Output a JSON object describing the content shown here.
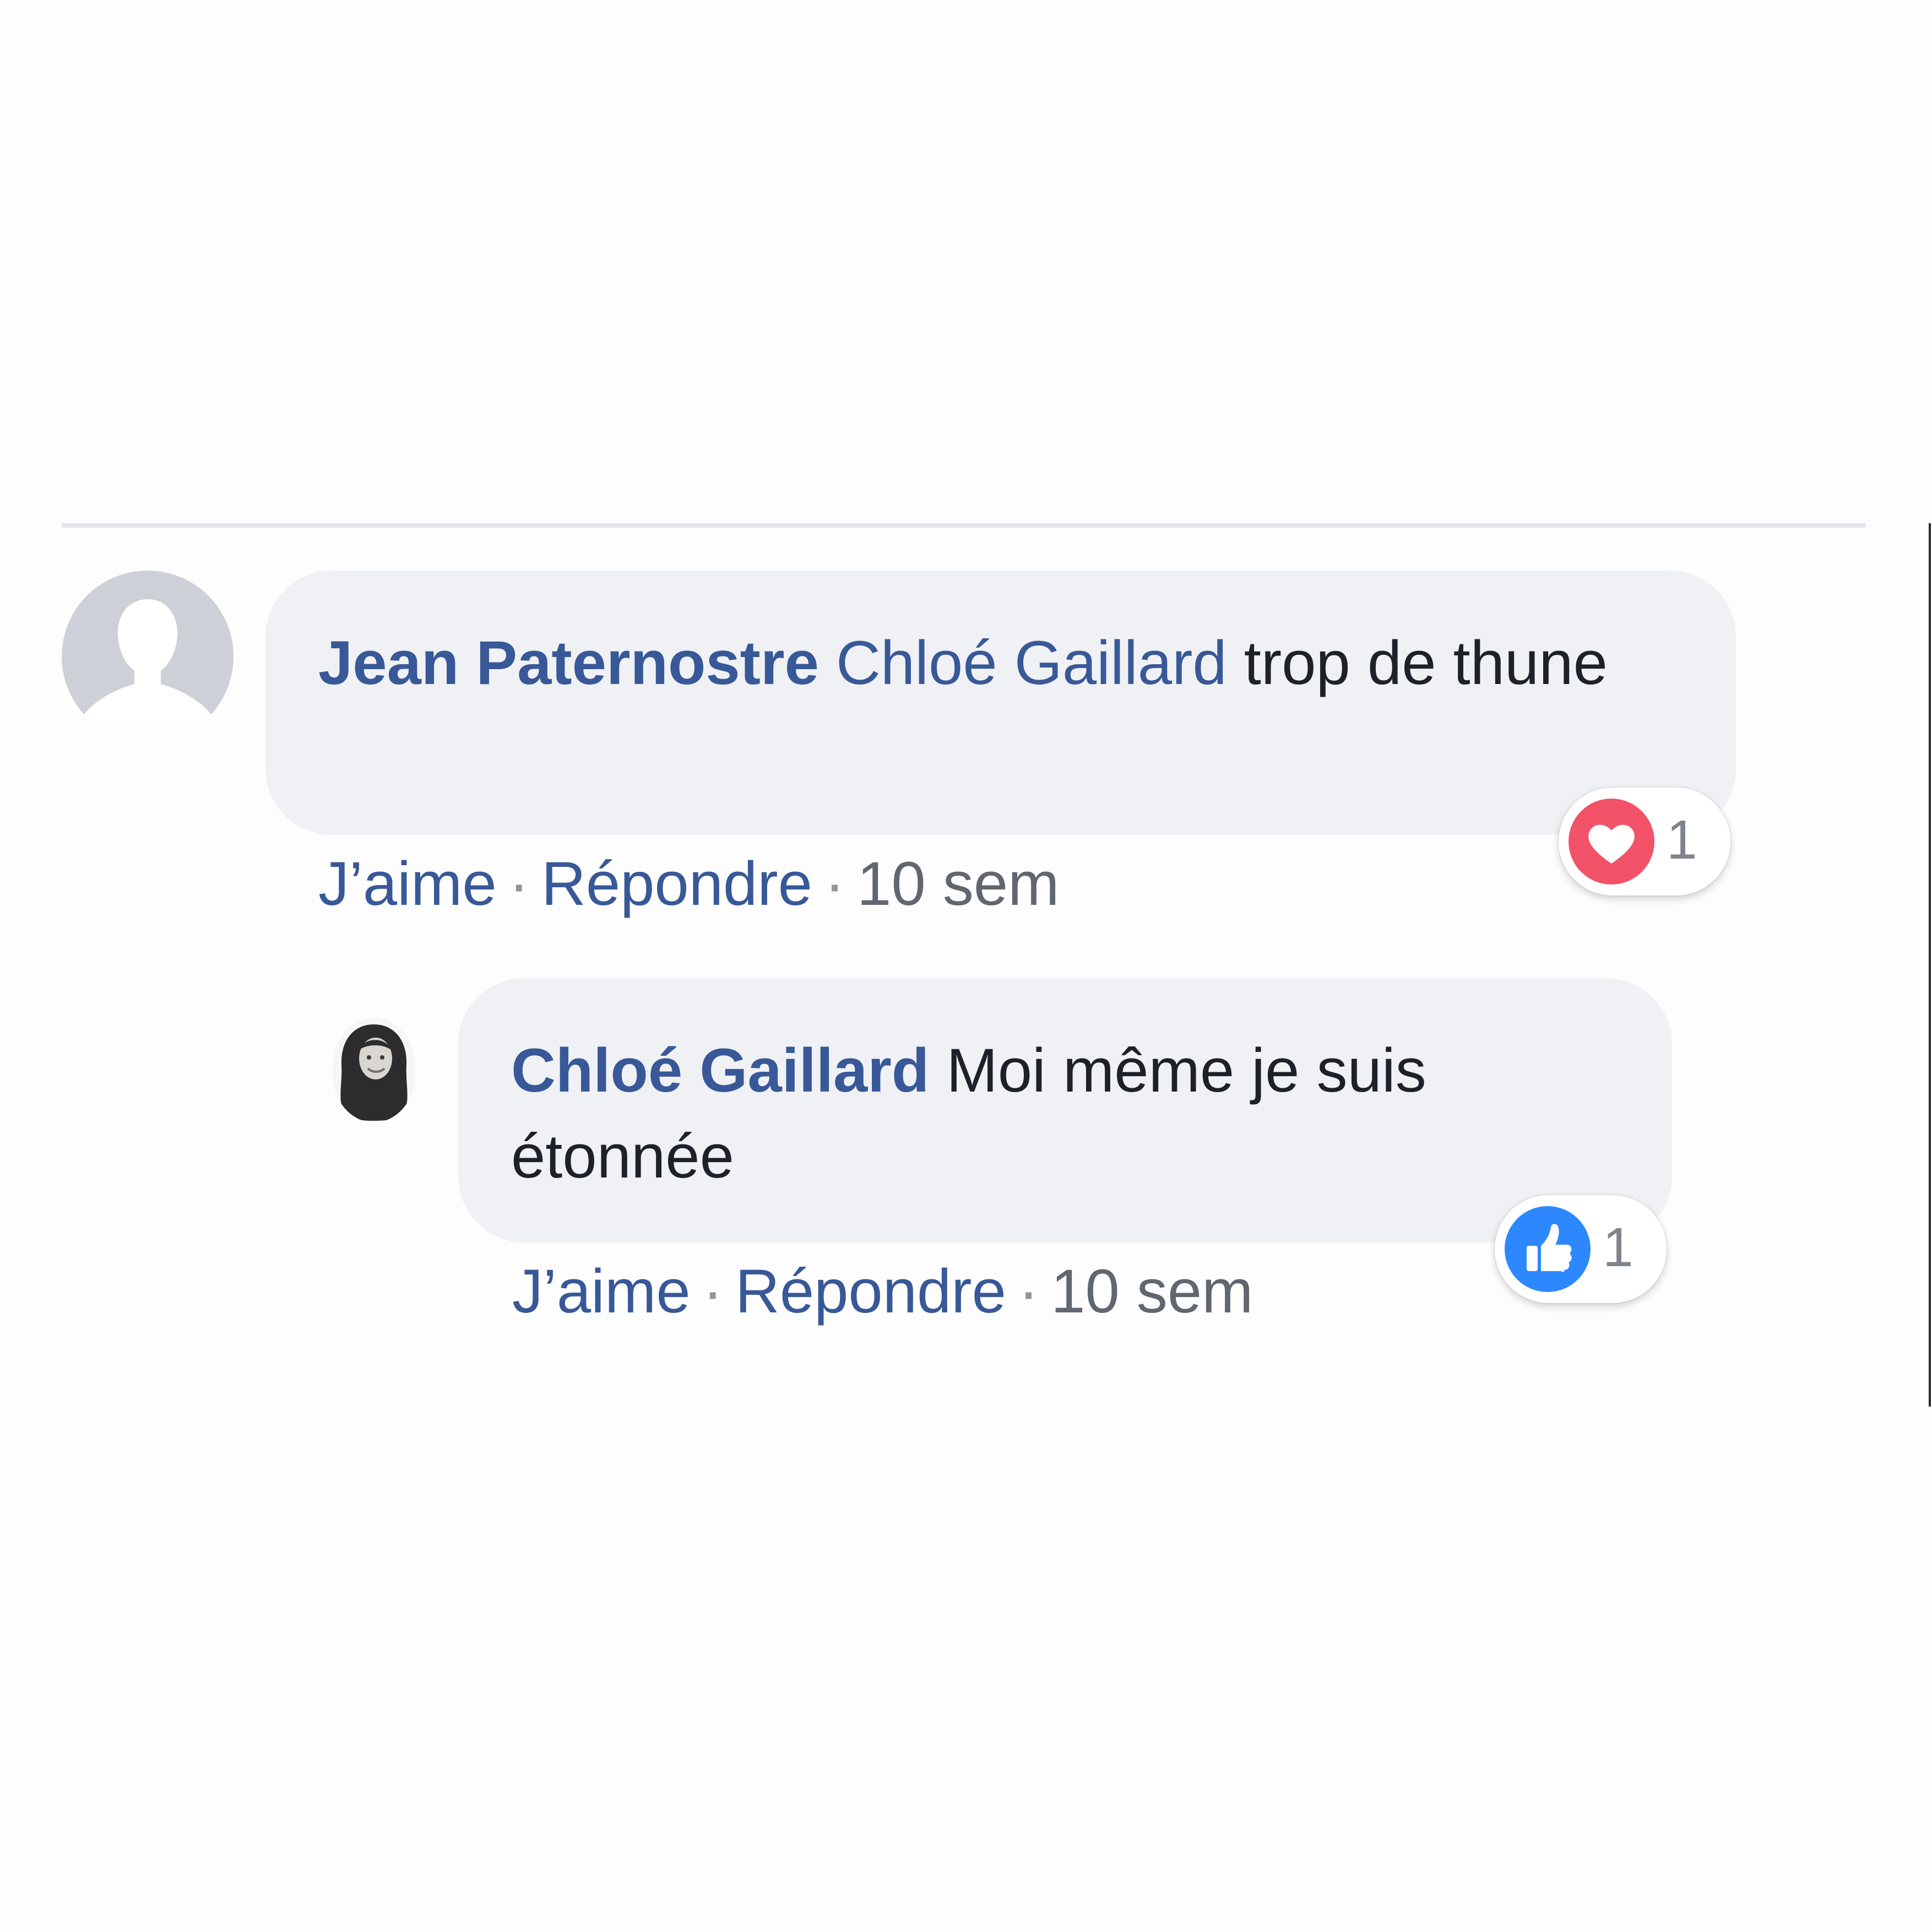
{
  "colors": {
    "link_blue": "#385898",
    "text_dark": "#1d2129",
    "meta_gray": "#616770",
    "bubble_bg": "#f0f1f4",
    "love_red": "#f25268",
    "like_blue": "#2d88ff"
  },
  "comment": {
    "avatar_icon": "default-profile-silhouette",
    "author": "Jean Paternostre",
    "mention": "Chloé Gaillard",
    "text": " trop de thune",
    "actions": {
      "like": "J’aime",
      "sep1": "·",
      "reply": "Répondre",
      "sep2": "·",
      "time": "10 sem"
    },
    "reaction": {
      "icon": "heart-icon",
      "count": "1"
    }
  },
  "reply": {
    "avatar_icon": "user-photo",
    "author": "Chloé Gaillard",
    "text": " Moi même je suis étonnée",
    "actions": {
      "like": "J’aime",
      "sep1": "·",
      "reply": "Répondre",
      "sep2": "·",
      "time": "10 sem"
    },
    "reaction": {
      "icon": "thumbs-up-icon",
      "count": "1"
    }
  }
}
